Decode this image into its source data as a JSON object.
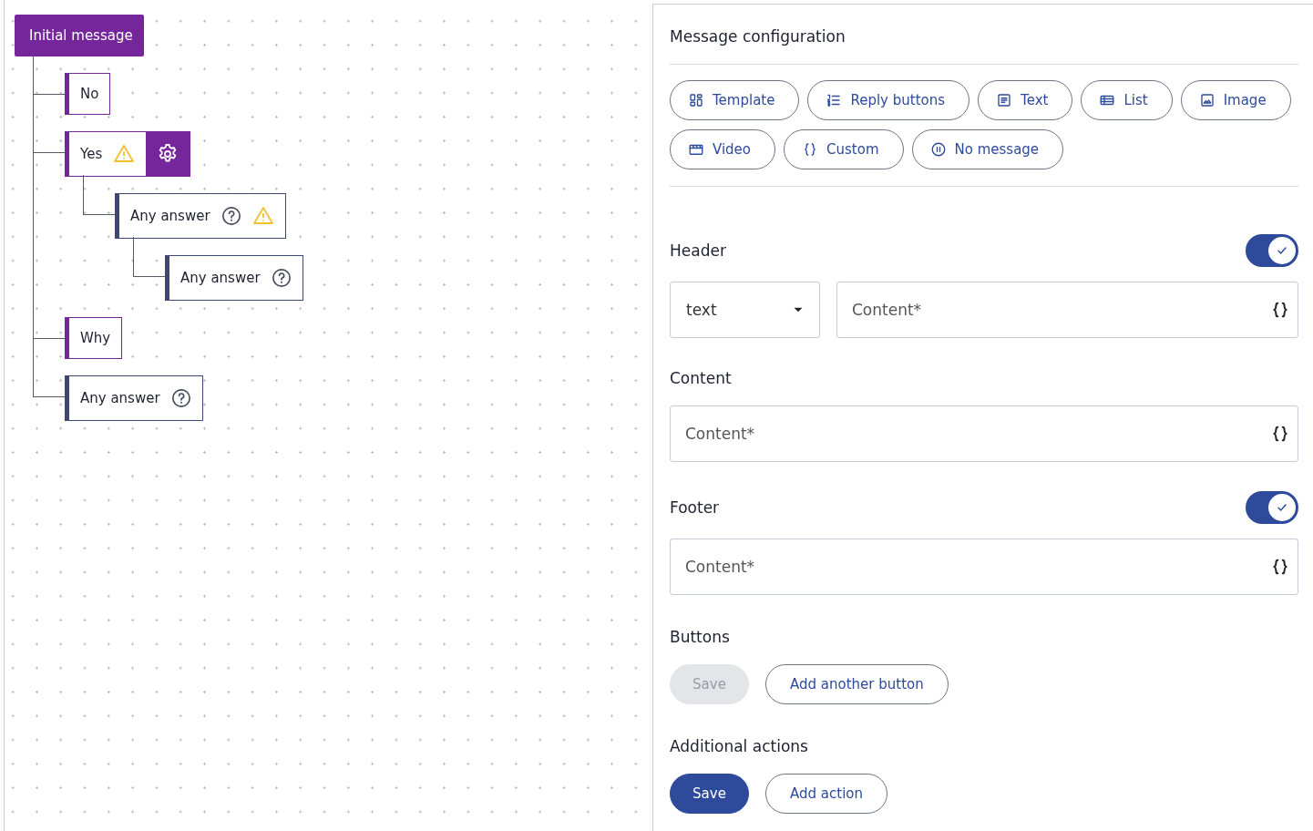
{
  "tree": [
    {
      "label": "Initial message",
      "kind": "message",
      "selected": false,
      "warning": false,
      "help": false,
      "children": [
        {
          "label": "No",
          "kind": "option",
          "selected": false,
          "warning": false,
          "help": false
        },
        {
          "label": "Yes",
          "kind": "option",
          "selected": true,
          "warning": true,
          "help": false,
          "children": [
            {
              "label": "Any answer",
              "kind": "answer",
              "selected": false,
              "warning": true,
              "help": true,
              "children": [
                {
                  "label": "Any answer",
                  "kind": "answer",
                  "selected": false,
                  "warning": false,
                  "help": true
                }
              ]
            }
          ]
        },
        {
          "label": "Why",
          "kind": "option",
          "selected": false,
          "warning": false,
          "help": false
        },
        {
          "label": "Any answer",
          "kind": "answer",
          "selected": false,
          "warning": false,
          "help": true
        }
      ]
    }
  ],
  "panel": {
    "title": "Message configuration",
    "types": [
      {
        "label": "Template",
        "kind": "template",
        "selected": false
      },
      {
        "label": "Reply buttons",
        "kind": "reply",
        "selected": false
      },
      {
        "label": "Text",
        "kind": "text",
        "selected": false
      },
      {
        "label": "List",
        "kind": "list",
        "selected": false
      },
      {
        "label": "Image",
        "kind": "image",
        "selected": false
      },
      {
        "label": "Video",
        "kind": "video",
        "selected": false
      },
      {
        "label": "Custom",
        "kind": "custom",
        "selected": false
      },
      {
        "label": "No message",
        "kind": "none",
        "selected": false
      }
    ],
    "header": {
      "label": "Header",
      "on": true,
      "type_value": "text",
      "placeholder": "Content*"
    },
    "content": {
      "label": "Content",
      "placeholder": "Content*"
    },
    "footer": {
      "label": "Footer",
      "on": true,
      "placeholder": "Content*"
    },
    "buttons": {
      "label": "Buttons",
      "actions": [
        {
          "label": "Save",
          "disabled": true,
          "primary": true
        },
        {
          "label": "Add another button",
          "disabled": false,
          "primary": false
        }
      ]
    },
    "additional": {
      "label": "Additional actions",
      "actions": [
        {
          "label": "Save",
          "disabled": false,
          "primary": true
        },
        {
          "label": "Add action",
          "disabled": false,
          "primary": false
        }
      ]
    }
  }
}
